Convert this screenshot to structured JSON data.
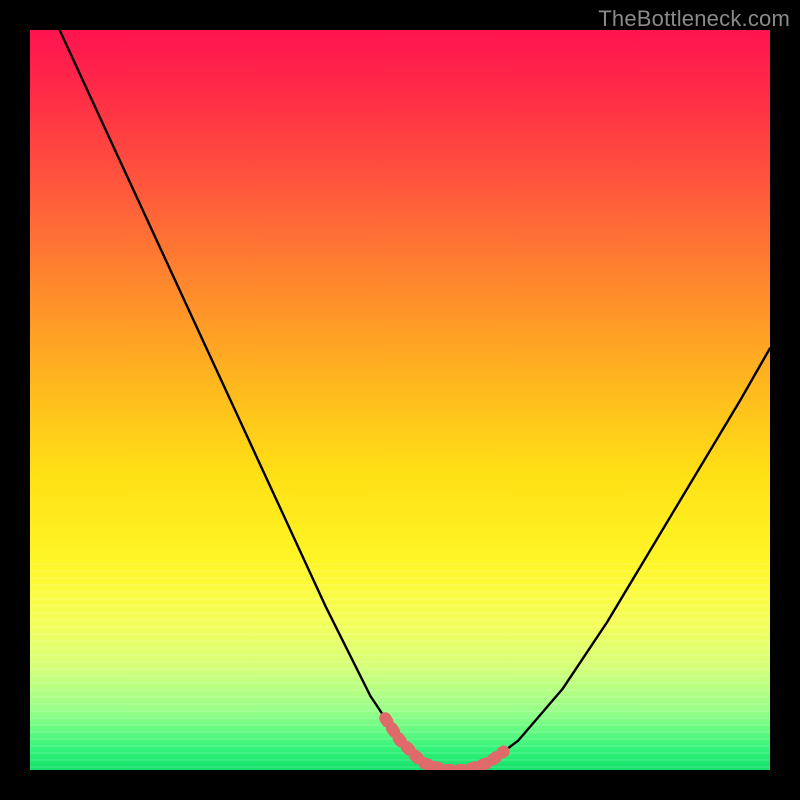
{
  "watermark": {
    "text": "TheBottleneck.com"
  },
  "colors": {
    "frame": "#000000",
    "curve": "#000000",
    "highlight": "#e06a6a",
    "gradient_stops": [
      "#ff1450",
      "#ff2a47",
      "#ff5a3c",
      "#ff8a2c",
      "#ffb81e",
      "#ffe015",
      "#fff627",
      "#f5ff5a",
      "#d6ff7a",
      "#98ff8a",
      "#36f47a",
      "#13e06b"
    ]
  },
  "chart_data": {
    "type": "line",
    "title": "",
    "xlabel": "",
    "ylabel": "",
    "xlim": [
      0,
      100
    ],
    "ylim": [
      0,
      100
    ],
    "grid": false,
    "legend": null,
    "series": [
      {
        "name": "bottleneck-curve",
        "x": [
          4,
          10,
          16,
          22,
          28,
          34,
          40,
          46,
          50,
          53,
          56,
          59,
          62,
          66,
          72,
          78,
          84,
          90,
          96,
          100
        ],
        "y": [
          100,
          87,
          74,
          61,
          48,
          35,
          22,
          10,
          4,
          1,
          0,
          0,
          1,
          4,
          11,
          20,
          30,
          40,
          50,
          57
        ]
      }
    ],
    "annotations": [
      {
        "name": "optimal-range-highlight",
        "x_range": [
          48,
          64
        ],
        "note": "thick pink bracket marking the flat minimum of the curve"
      }
    ]
  }
}
